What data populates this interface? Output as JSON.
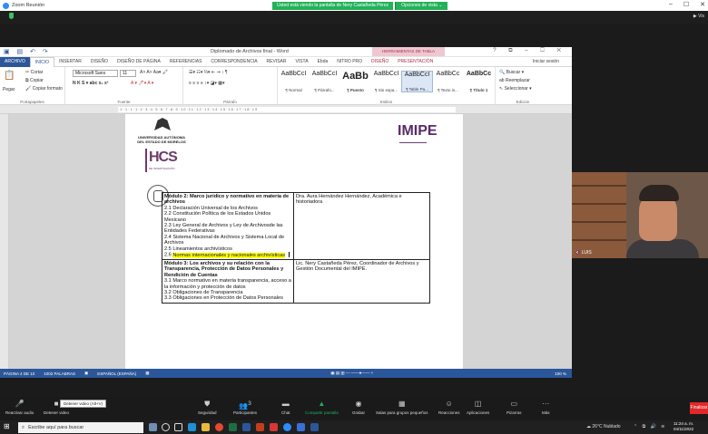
{
  "zoom": {
    "window_title": "Zoom Reunión",
    "share_message": "Usted está viendo la pantalla de Nery Castañeda Pérez",
    "view_options": "Opciones de vista ⌄",
    "view_button": "▶ Vis",
    "participant_name": "LUIS",
    "toolbar": {
      "unmute": "Reactivar audio",
      "stop_video": "Detener video",
      "security": "Seguridad",
      "participants": "Participantes",
      "participants_count": "3",
      "chat": "Chat",
      "share": "Compartir pantalla",
      "record": "Grabar",
      "breakout": "Salas para grupos pequeños",
      "reactions": "Reacciones",
      "apps": "Aplicaciones",
      "whiteboards": "Pizarras",
      "more": "Más",
      "end": "Finalizar",
      "tooltip": "Detener video (Alt+V)"
    }
  },
  "word": {
    "doc_title": "Diplomado de Archivos final - Word",
    "context_tools": "HERRAMIENTAS DE TABLA",
    "window_controls": "? ⧉ – ☐ ✕",
    "tabs": [
      "ARCHIVO",
      "INICIO",
      "INSERTAR",
      "DISEÑO",
      "DISEÑO DE PÁGINA",
      "REFERENCIAS",
      "CORRESPONDENCIA",
      "REVISAR",
      "VISTA",
      "Ebda",
      "NITRO PRO",
      "DISEÑO",
      "PRESENTACIÓN"
    ],
    "signin": "Iniciar sesión",
    "ribbon": {
      "paste": "Pegar",
      "cut": "✂ Cortar",
      "copy": "⧉ Copiar",
      "format_painter": "🖌 Copiar formato",
      "clipboard_group": "Portapapeles",
      "font_name": "Microsoft Sans",
      "font_size": "11",
      "font_group": "Fuente",
      "paragraph_group": "Párrafo",
      "styles_group": "Estilos",
      "editing_group": "Edición",
      "find": "Buscar",
      "replace": "Reemplazar",
      "select": "Seleccionar",
      "styles": [
        {
          "preview": "AaBbCcI",
          "name": "¶ Normal"
        },
        {
          "preview": "AaBbCcI",
          "name": "¶ Párrafo..."
        },
        {
          "preview": "AaBb",
          "name": "¶ Puesto"
        },
        {
          "preview": "AaBbCcI",
          "name": "¶ Sin espa..."
        },
        {
          "preview": "AaBbCcI",
          "name": "¶ Table Pa..."
        },
        {
          "preview": "AaBbCc",
          "name": "¶ Texto in..."
        },
        {
          "preview": "AaBbCc",
          "name": "¶ Título 1"
        }
      ]
    },
    "ruler_text": "·2·1·1·1·2·3·4·5·6·7·8·9·10·11·12·13·14·15·16·17·18·19",
    "status": {
      "page": "PÁGINA 4 DE 10",
      "words": "1002 PALABRAS",
      "lang": "ESPAÑOL (ESPAÑA)",
      "zoom": "100 %"
    },
    "document": {
      "uaem": "UNIVERSIDAD AUTÓNOMA DEL ESTADO DE MORELOS",
      "hcs": "HCS",
      "hcs_sub": "DE INVESTIGACIÓN",
      "imipe": "IMIPE",
      "module2_title": "Módulo 2: Marco jurídico y normativo en materia de archivos",
      "module2_items": [
        "2.1 Declaración Universal de los Archivos",
        "2.2 Constitución Política de los Estados Unidos Mexicano",
        "2.3 Ley General de Archivos y Ley de Archivosde las Entidades Federativas",
        "2.4 Sistema Nacional de Archivos y Sistema Local de Archivos",
        "2.5 Lineamientos archivísticos"
      ],
      "module2_hl_prefix": "2.6 ",
      "module2_hl_text": "Normas internacionales y nacionales archivísticas",
      "module2_teacher": "Dra. Aura Hernández Hernández, Académica e historiadora",
      "module3_title": "Módulo 3: Los archivos y su relación con la Transparencia, Protección de Datos Personales y Rendición de Cuentas",
      "module3_items": [
        "3.1 Marco normativo en materia transparencia, acceso a la información y protección de datos",
        "3.2 Obligaciones de Transparencia",
        "3.3 Obligaciones en Protección de Datos Personales"
      ],
      "module3_teacher": "Lic. Nery Castañeda Pérez, Coordinador de Archivos y Gestión Documental del IMIPE."
    }
  },
  "taskbar": {
    "search_placeholder": "Escribe aquí para buscar",
    "weather": "26°C Nublado",
    "time": "11:24 a. m.",
    "date": "04/11/2022"
  }
}
